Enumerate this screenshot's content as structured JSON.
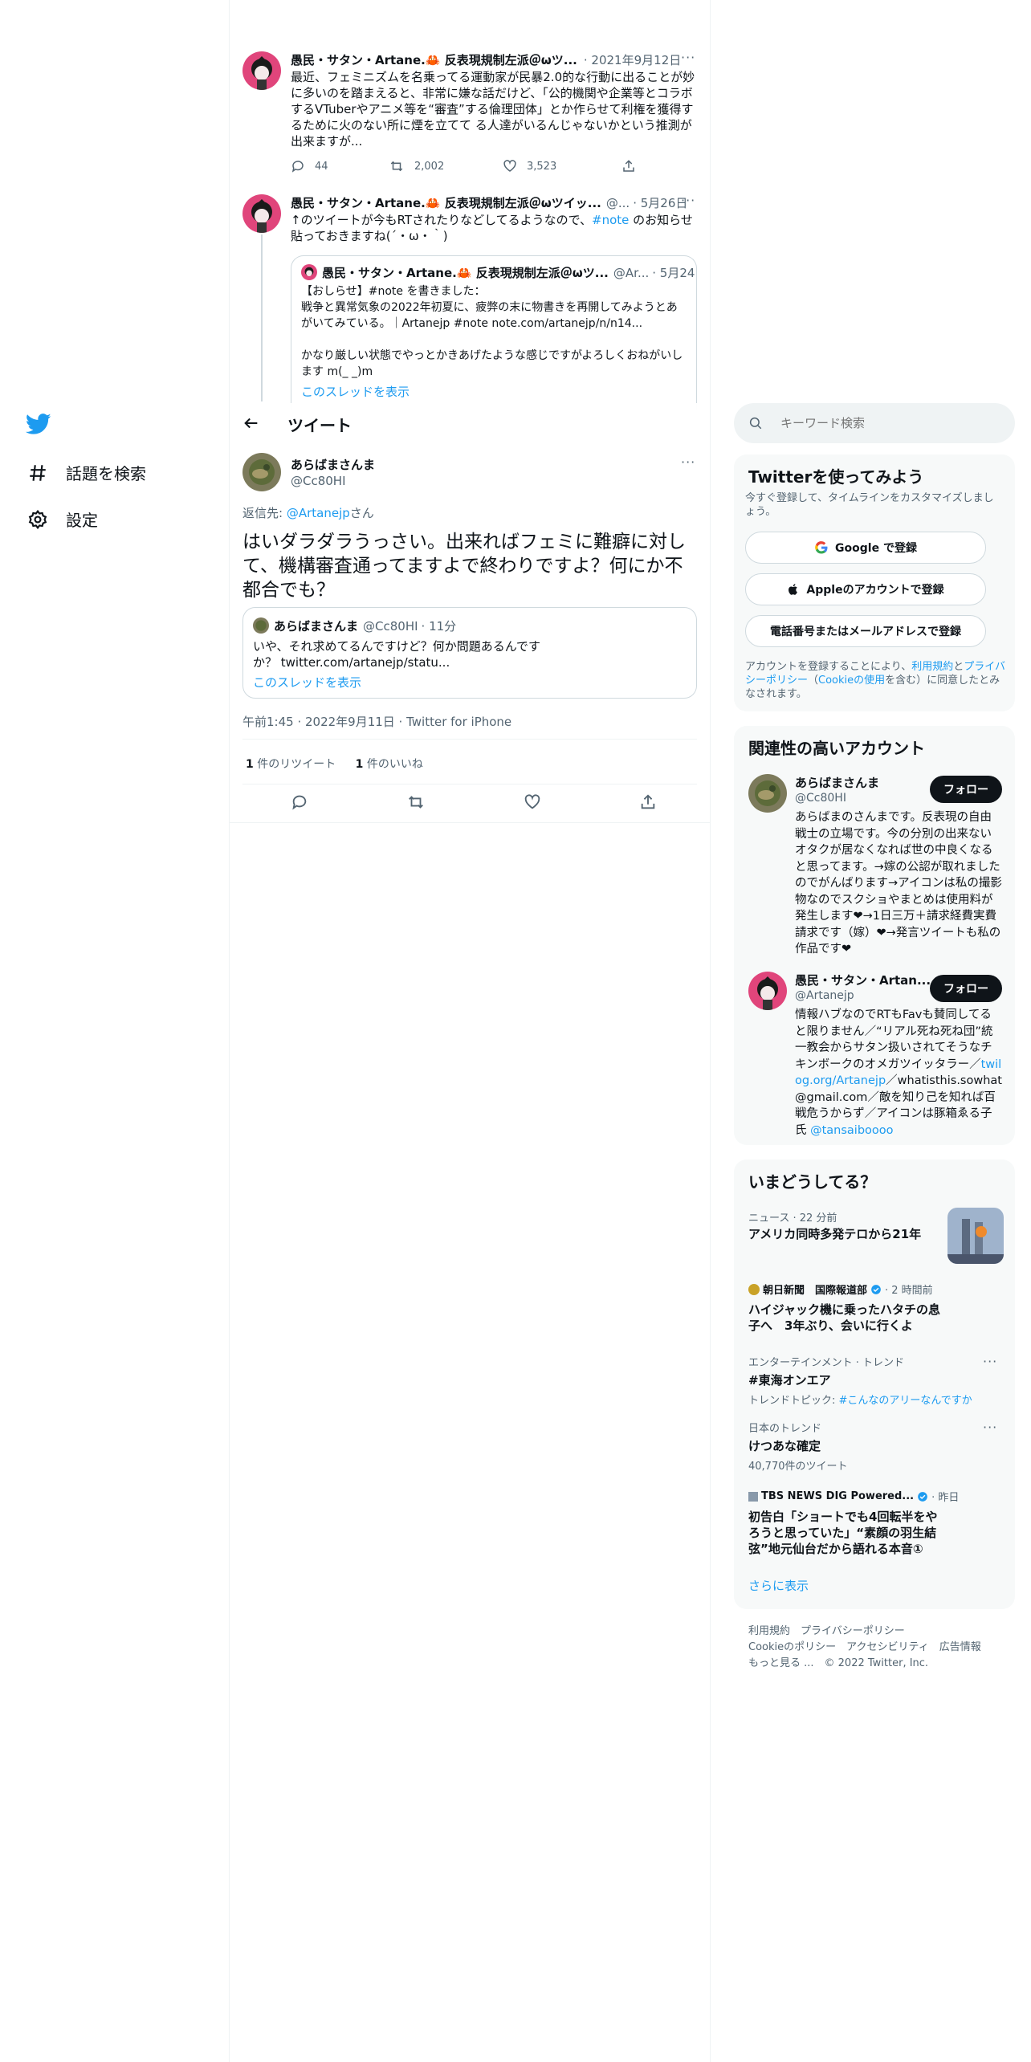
{
  "nav": {
    "explore": "話題を検索",
    "settings": "設定"
  },
  "header": {
    "title": "ツイート"
  },
  "tweet1": {
    "name": "愚民・サタン・Artane.🦀 反表現規制左派＠ωツ...",
    "date": "· 2021年9月12日",
    "text": "最近、フェミニズムを名乗ってる運動家が民暴2.0的な行動に出ることが妙に多いのを踏まえると、非常に嫌な話だけど、「公的機関や企業等とコラボするVTuberやアニメ等を“審査”する倫理団体」とか作らせて利権を獲得するために火のない所に煙を立てて る人達がいるんじゃないかという推測が出来ますが...",
    "replies": "44",
    "retweets": "2,002",
    "likes": "3,523"
  },
  "tweet2": {
    "name": "愚民・サタン・Artane.🦀 反表現規制左派＠ωツイッ...",
    "handle": "@...",
    "date": "· 5月26日",
    "text_before": "↑のツイートが今もRTされたりなどしてるようなので、",
    "hashtag": "#note",
    "text_after": " のお知らせ貼っておきますね(´・ω・｀)",
    "quote": {
      "name": "愚民・サタン・Artane.🦀 反表現規制左派＠ωツ...",
      "handle": "@Ar...",
      "date": "· 5月24日",
      "text1": "【おしらせ】#note を書きました：",
      "text2": "戦争と異常気象の2022年初夏に、疲弊の末に物書きを再開してみようとあがいてみている。｜Artanejp #note note.com/artanejp/n/n14...",
      "text3": "かなり厳しい状態でやっとかきあげたような感じですがよろしくおねがいします m(_ _)m",
      "thread": "このスレッドを表示"
    }
  },
  "main_tweet": {
    "name": "あらばまさんま",
    "handle": "@Cc80HI",
    "reply_to_prefix": "返信先: ",
    "reply_to_handle": "@Artanejp",
    "reply_to_suffix": "さん",
    "text": "はいダラダラうっさい。出来ればフェミに難癖に対して、機構審査通ってますよで終わりですよ？何にか不都合でも？",
    "quote": {
      "name": "あらばまさんま",
      "handle": "@Cc80HI",
      "time": "· 11分",
      "text": "いや、それ求めてるんですけど？何か問題あるんですか？ twitter.com/artanejp/statu...",
      "thread": "このスレッドを表示"
    },
    "timestamp": "午前1:45 · 2022年9月11日 · Twitter for iPhone",
    "retweet_count": "1",
    "retweet_label": " 件のリツイート",
    "like_count": "1",
    "like_label": " 件のいいね"
  },
  "search": {
    "placeholder": "キーワード検索"
  },
  "signup": {
    "title": "Twitterを使ってみよう",
    "subtitle": "今すぐ登録して、タイムラインをカスタマイズしましょう。",
    "google": "Google で登録",
    "apple": "Appleのアカウントで登録",
    "phone": "電話番号またはメールアドレスで登録",
    "terms_a": "アカウントを登録することにより、",
    "terms_link1": "利用規約",
    "terms_b": "と",
    "terms_link2": "プライバシーポリシー",
    "terms_c": "（",
    "terms_link3": "Cookieの使用",
    "terms_d": "を含む）に同意したとみなされます。"
  },
  "related": {
    "title": "関連性の高いアカウント",
    "follow": "フォロー",
    "accounts": [
      {
        "name": "あらばまさんま",
        "handle": "@Cc80HI",
        "bio": "あらばまのさんまです。反表現の自由戦士の立場です。今の分別の出来ないオタクが居なくなれば世の中良くなると思ってます。→嫁の公認が取れましたのでがんばります→アイコンは私の撮影物なのでスクショやまとめは使用料が発生します❤→1日三万＋請求経費実費請求です（嫁）❤→発言ツイートも私の作品です❤"
      },
      {
        "name": "愚民・サタン・Artan...",
        "handle": "@Artanejp",
        "bio_a": "情報ハブなのでRTもFavも賛同してると限りません／“リアル死ね死ね団”統一教会からサタン扱いされてそうなチキンボークのオメガツイッタラー／",
        "bio_link": "twilog.org/Artanejp",
        "bio_b": "／whatisthis.sowhat@gmail.com／敵を知り己を知れば百戦危うからず／アイコンは豚箱ゑる子氏 ",
        "bio_link2": "@tansaiboooo"
      }
    ]
  },
  "trends": {
    "title": "いまどうしてる？",
    "items": [
      {
        "meta": "ニュース · 22 分前",
        "title": "アメリカ同時多発テロから21年"
      },
      {
        "source": "朝日新聞　国際報道部",
        "meta": " · 2 時間前",
        "title": "ハイジャック機に乗ったハタチの息子へ　3年ぶり、会いに行くよ"
      },
      {
        "meta": "エンターテインメント · トレンド",
        "title": "#東海オンエア",
        "sub_prefix": "トレンドトピック: ",
        "sub_link": "#こんなのアリーなんですか"
      },
      {
        "meta": "日本のトレンド",
        "title": "けつあな確定",
        "sub": "40,770件のツイート"
      },
      {
        "source": "TBS NEWS DIG Powered...",
        "meta": " · 昨日",
        "title": "初告白「ショートでも4回転半をやろうと思っていた」“素顔の羽生結弦”地元仙台だから語れる本音①"
      }
    ],
    "more": "さらに表示"
  },
  "footer": {
    "line1": "利用規約　プライバシーポリシー",
    "line2": "Cookieのポリシー　アクセシビリティ　広告情報",
    "line3": "もっと見る ...　© 2022 Twitter, Inc."
  },
  "colors": {
    "accent": "#1d9bf0",
    "text": "#0f1419",
    "muted": "#536471",
    "border": "#eff3f4",
    "panel": "#f7f9f9"
  }
}
